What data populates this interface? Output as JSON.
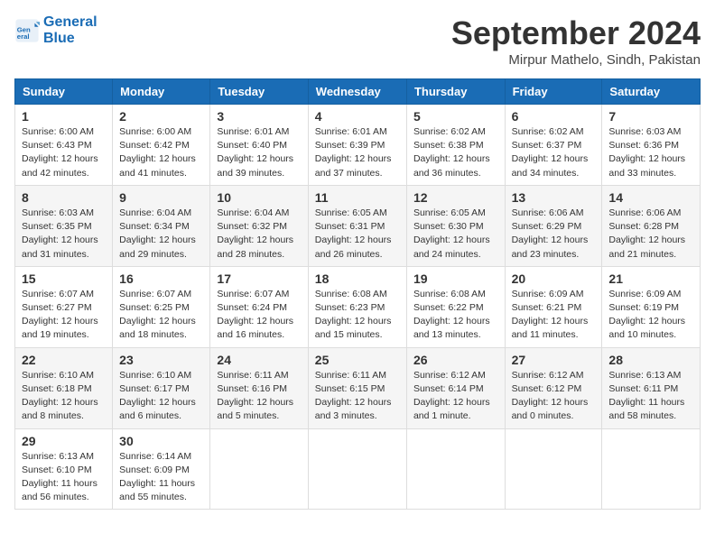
{
  "header": {
    "logo_line1": "General",
    "logo_line2": "Blue",
    "month": "September 2024",
    "location": "Mirpur Mathelo, Sindh, Pakistan"
  },
  "days_of_week": [
    "Sunday",
    "Monday",
    "Tuesday",
    "Wednesday",
    "Thursday",
    "Friday",
    "Saturday"
  ],
  "weeks": [
    [
      {
        "day": "1",
        "sunrise": "6:00 AM",
        "sunset": "6:43 PM",
        "daylight": "12 hours and 42 minutes."
      },
      {
        "day": "2",
        "sunrise": "6:00 AM",
        "sunset": "6:42 PM",
        "daylight": "12 hours and 41 minutes."
      },
      {
        "day": "3",
        "sunrise": "6:01 AM",
        "sunset": "6:40 PM",
        "daylight": "12 hours and 39 minutes."
      },
      {
        "day": "4",
        "sunrise": "6:01 AM",
        "sunset": "6:39 PM",
        "daylight": "12 hours and 37 minutes."
      },
      {
        "day": "5",
        "sunrise": "6:02 AM",
        "sunset": "6:38 PM",
        "daylight": "12 hours and 36 minutes."
      },
      {
        "day": "6",
        "sunrise": "6:02 AM",
        "sunset": "6:37 PM",
        "daylight": "12 hours and 34 minutes."
      },
      {
        "day": "7",
        "sunrise": "6:03 AM",
        "sunset": "6:36 PM",
        "daylight": "12 hours and 33 minutes."
      }
    ],
    [
      {
        "day": "8",
        "sunrise": "6:03 AM",
        "sunset": "6:35 PM",
        "daylight": "12 hours and 31 minutes."
      },
      {
        "day": "9",
        "sunrise": "6:04 AM",
        "sunset": "6:34 PM",
        "daylight": "12 hours and 29 minutes."
      },
      {
        "day": "10",
        "sunrise": "6:04 AM",
        "sunset": "6:32 PM",
        "daylight": "12 hours and 28 minutes."
      },
      {
        "day": "11",
        "sunrise": "6:05 AM",
        "sunset": "6:31 PM",
        "daylight": "12 hours and 26 minutes."
      },
      {
        "day": "12",
        "sunrise": "6:05 AM",
        "sunset": "6:30 PM",
        "daylight": "12 hours and 24 minutes."
      },
      {
        "day": "13",
        "sunrise": "6:06 AM",
        "sunset": "6:29 PM",
        "daylight": "12 hours and 23 minutes."
      },
      {
        "day": "14",
        "sunrise": "6:06 AM",
        "sunset": "6:28 PM",
        "daylight": "12 hours and 21 minutes."
      }
    ],
    [
      {
        "day": "15",
        "sunrise": "6:07 AM",
        "sunset": "6:27 PM",
        "daylight": "12 hours and 19 minutes."
      },
      {
        "day": "16",
        "sunrise": "6:07 AM",
        "sunset": "6:25 PM",
        "daylight": "12 hours and 18 minutes."
      },
      {
        "day": "17",
        "sunrise": "6:07 AM",
        "sunset": "6:24 PM",
        "daylight": "12 hours and 16 minutes."
      },
      {
        "day": "18",
        "sunrise": "6:08 AM",
        "sunset": "6:23 PM",
        "daylight": "12 hours and 15 minutes."
      },
      {
        "day": "19",
        "sunrise": "6:08 AM",
        "sunset": "6:22 PM",
        "daylight": "12 hours and 13 minutes."
      },
      {
        "day": "20",
        "sunrise": "6:09 AM",
        "sunset": "6:21 PM",
        "daylight": "12 hours and 11 minutes."
      },
      {
        "day": "21",
        "sunrise": "6:09 AM",
        "sunset": "6:19 PM",
        "daylight": "12 hours and 10 minutes."
      }
    ],
    [
      {
        "day": "22",
        "sunrise": "6:10 AM",
        "sunset": "6:18 PM",
        "daylight": "12 hours and 8 minutes."
      },
      {
        "day": "23",
        "sunrise": "6:10 AM",
        "sunset": "6:17 PM",
        "daylight": "12 hours and 6 minutes."
      },
      {
        "day": "24",
        "sunrise": "6:11 AM",
        "sunset": "6:16 PM",
        "daylight": "12 hours and 5 minutes."
      },
      {
        "day": "25",
        "sunrise": "6:11 AM",
        "sunset": "6:15 PM",
        "daylight": "12 hours and 3 minutes."
      },
      {
        "day": "26",
        "sunrise": "6:12 AM",
        "sunset": "6:14 PM",
        "daylight": "12 hours and 1 minute."
      },
      {
        "day": "27",
        "sunrise": "6:12 AM",
        "sunset": "6:12 PM",
        "daylight": "12 hours and 0 minutes."
      },
      {
        "day": "28",
        "sunrise": "6:13 AM",
        "sunset": "6:11 PM",
        "daylight": "11 hours and 58 minutes."
      }
    ],
    [
      {
        "day": "29",
        "sunrise": "6:13 AM",
        "sunset": "6:10 PM",
        "daylight": "11 hours and 56 minutes."
      },
      {
        "day": "30",
        "sunrise": "6:14 AM",
        "sunset": "6:09 PM",
        "daylight": "11 hours and 55 minutes."
      },
      null,
      null,
      null,
      null,
      null
    ]
  ]
}
